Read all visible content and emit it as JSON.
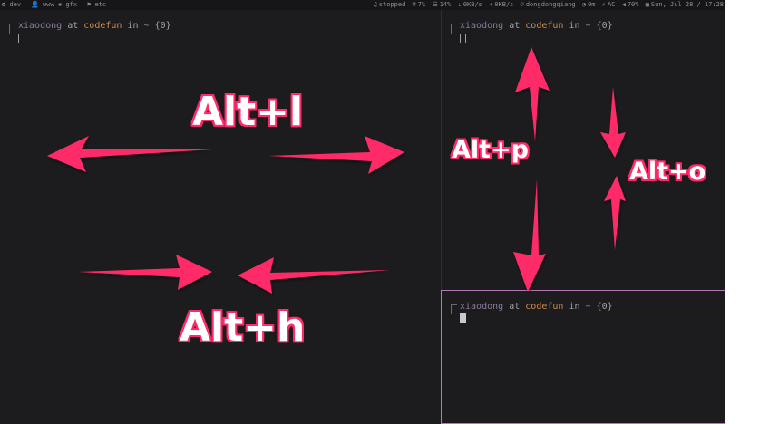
{
  "topbar": {
    "workspaces": [
      "dev",
      "www",
      "gfx",
      "etc"
    ],
    "status": {
      "mpd": "stopped",
      "cpu": "7%",
      "mem": "14%",
      "down": "0KB/s",
      "up": "0KB/s",
      "user": "dongdongqiang",
      "uptime": "0m",
      "power": "AC",
      "volume": "70%",
      "datetime": "Sun, Jul 28 / 17:28"
    }
  },
  "terminals": [
    {
      "user": "xiaodong",
      "at": "at",
      "host": "codefun",
      "in": "in",
      "path": "~",
      "ws": "{0}"
    },
    {
      "user": "xiaodong",
      "at": "at",
      "host": "codefun",
      "in": "in",
      "path": "~",
      "ws": "{0}"
    },
    {
      "user": "xiaodong",
      "at": "at",
      "host": "codefun",
      "in": "in",
      "path": "~",
      "ws": "{0}"
    }
  ],
  "annotations": {
    "alt_l": "Alt+l",
    "alt_h": "Alt+h",
    "alt_p": "Alt+p",
    "alt_o": "Alt+o"
  },
  "colors": {
    "arrow": "#ff2a68",
    "active_border": "#b478b4",
    "background": "#1c1c1e"
  }
}
